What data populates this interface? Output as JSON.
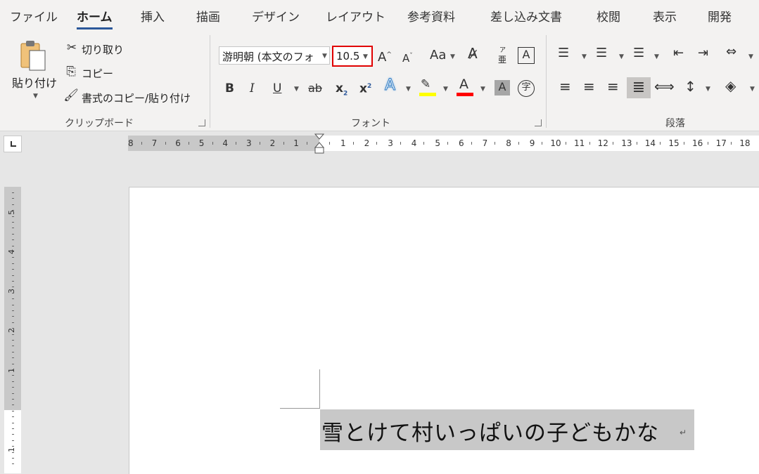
{
  "tabs": [
    "ファイル",
    "ホーム",
    "挿入",
    "描画",
    "デザイン",
    "レイアウト",
    "参考資料",
    "差し込み文書",
    "校閲",
    "表示",
    "開発"
  ],
  "active_tab": "ホーム",
  "clipboard": {
    "paste_label": "貼り付け",
    "cut_label": "切り取り",
    "copy_label": "コピー",
    "format_painter_label": "書式のコピー/貼り付け",
    "group_label": "クリップボード"
  },
  "font": {
    "font_name": "游明朝 (本文のフォ",
    "font_size": "10.5",
    "group_label": "フォント",
    "grow_label": "A",
    "shrink_label": "A",
    "case_label": "Aa",
    "bold": "B",
    "italic": "I",
    "underline": "U",
    "strike": "ab",
    "subscript": "x",
    "superscript": "x",
    "text_effect": "A",
    "font_color": "A",
    "shading": "A",
    "enclose": "字",
    "phonetic_top": "ア",
    "phonetic_bottom": "亜",
    "border": "A",
    "highlight_color": "#ffff00",
    "font_color_value": "#ff0000"
  },
  "paragraph": {
    "group_label": "段落"
  },
  "ruler": {
    "left_numbers": [
      "8",
      "7",
      "6",
      "5",
      "4",
      "3",
      "2",
      "1"
    ],
    "right_numbers": [
      "1",
      "2",
      "3",
      "4",
      "5",
      "6",
      "7",
      "8",
      "9",
      "10",
      "11",
      "12",
      "13",
      "14",
      "15",
      "16",
      "17",
      "18"
    ],
    "vertical_numbers": [
      "5",
      "4",
      "3",
      "2",
      "1",
      "1"
    ]
  },
  "document": {
    "text": "雪とけて村いっぱいの子どもかな",
    "para_mark": "↵"
  },
  "highlight_box_color": "#e00000"
}
